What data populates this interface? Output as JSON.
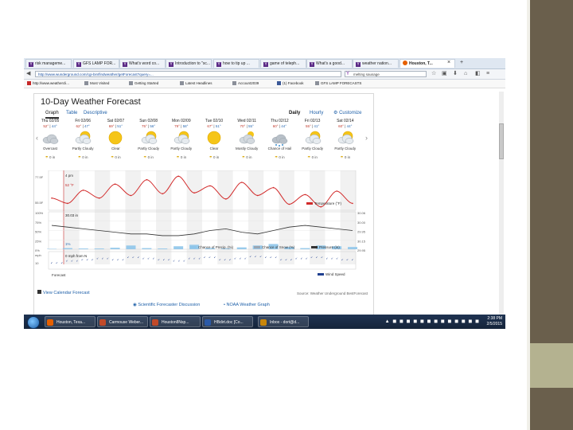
{
  "browser": {
    "tabs": [
      {
        "label": "risk manageme...",
        "icon": "Y"
      },
      {
        "label": "GFS LAMP FOR...",
        "icon": "Y"
      },
      {
        "label": "What's word co...",
        "icon": "Y"
      },
      {
        "label": "Introduction to \"sc...",
        "icon": "Y"
      },
      {
        "label": "how to tip up ...",
        "icon": "Y"
      },
      {
        "label": "game of teleph...",
        "icon": "Y"
      },
      {
        "label": "What's a good...",
        "icon": "Y"
      },
      {
        "label": "weather nation...",
        "icon": "Y"
      },
      {
        "label": "Houston, T...",
        "icon": "ff",
        "active": true
      }
    ],
    "close_tab": "×",
    "new_tab": "+",
    "url": "http://www.wunderground.com/cgi-bin/findweather/getForecast?query=...",
    "search_value": "melting sausage",
    "bookmarks": [
      "http://www.weathercli...",
      "Most Visited",
      "Getting Started",
      "Latest Headlines",
      "Account2039",
      "(1) Facebook",
      "GFS LAMP FORECASTS"
    ]
  },
  "page": {
    "title": "10-Day Weather Forecast",
    "tabs": [
      "Graph",
      "Table",
      "Descriptive"
    ],
    "active_tab": "Graph",
    "modes": [
      "Daily",
      "Hourly"
    ],
    "active_mode": "Daily",
    "customize": "Customize",
    "days": [
      {
        "day": "Thu 02/05",
        "hi": "52°",
        "lo": "44°",
        "icon": "cloudy",
        "cond": "Overcast",
        "precip": "0 in"
      },
      {
        "day": "Fri 02/06",
        "hi": "62°",
        "lo": "47°",
        "icon": "partly",
        "cond": "Partly Cloudy",
        "precip": "0 in"
      },
      {
        "day": "Sat 02/07",
        "hi": "69°",
        "lo": "51°",
        "icon": "sunny",
        "cond": "Clear",
        "precip": "0 in"
      },
      {
        "day": "Sun 02/08",
        "hi": "75°",
        "lo": "56°",
        "icon": "partly",
        "cond": "Partly Cloudy",
        "precip": "0 in"
      },
      {
        "day": "Mon 02/09",
        "hi": "79°",
        "lo": "58°",
        "icon": "partly",
        "cond": "Partly Cloudy",
        "precip": "0 in"
      },
      {
        "day": "Tue 02/10",
        "hi": "67°",
        "lo": "51°",
        "icon": "sunny",
        "cond": "Clear",
        "precip": "0 in"
      },
      {
        "day": "Wed 02/11",
        "hi": "70°",
        "lo": "55°",
        "icon": "mostly",
        "cond": "Mostly Cloudy",
        "precip": "0 in"
      },
      {
        "day": "Thu 02/12",
        "hi": "60°",
        "lo": "44°",
        "icon": "hail",
        "cond": "Chance of Hail",
        "precip": "0 in"
      },
      {
        "day": "Fri 02/13",
        "hi": "55°",
        "lo": "41°",
        "icon": "partly",
        "cond": "Partly Cloudy",
        "precip": "0 in"
      },
      {
        "day": "Sat 02/14",
        "hi": "60°",
        "lo": "44°",
        "icon": "partly",
        "cond": "Partly Cloudy",
        "precip": "0 in"
      }
    ],
    "prev_arrow": "‹",
    "next_arrow": "›",
    "graph": {
      "temp_annotation": "52 °F",
      "time_annotation": "4 pm",
      "pressure_annotation": "30.03 in",
      "precip_annotation": "1%",
      "wind_annotation": "0 mph from N",
      "forecast_label": "Forecast",
      "left_temp_ticks": [
        "77.5F",
        "55.5F"
      ],
      "left_pct_ticks": [
        "100%",
        "75%",
        "50%",
        "25%",
        "0%"
      ],
      "right_pressure_ticks": [
        "30.06",
        "30.00",
        "29.95",
        "30.15",
        "29.95"
      ],
      "left_wind_ticks": [
        "mph",
        "10"
      ],
      "legend_temp": "Temperature (°F)",
      "legend_precip": "Chance of Precip. (%)",
      "legend_snow": "Chance of Snow (%)",
      "legend_pressure": "Pressure (in)",
      "legend_wind": "Wind Speed",
      "source": "Source: Weather Underground BestForecast"
    },
    "view_calendar": "View Calendar Forecast",
    "scientific_link": "Scientific Forecaster Discussion",
    "nws_link": "NOAA Weather Graph"
  },
  "chart_data": {
    "type": "line",
    "title": "",
    "series": [
      {
        "name": "Temperature (°F)",
        "color": "#d22b2b",
        "values": [
          52,
          46,
          61,
          52,
          68,
          55,
          73,
          57,
          77,
          58,
          66,
          51,
          70,
          55,
          64,
          45,
          56,
          42,
          60,
          46
        ]
      },
      {
        "name": "Chance of Precip. (%)",
        "color": "#8ec5ea",
        "values": [
          1,
          3,
          2,
          2,
          4,
          10,
          3,
          2,
          8,
          12,
          3,
          2,
          5,
          10,
          14,
          6,
          3,
          10,
          8,
          6
        ]
      },
      {
        "name": "Pressure (in)",
        "color": "#333333",
        "values": [
          30.03,
          30.02,
          30.01,
          30.0,
          29.99,
          29.98,
          29.98,
          29.97,
          29.97,
          29.98,
          30.0,
          30.01,
          29.99,
          29.98,
          30.0,
          30.02,
          30.03,
          30.02,
          30.01,
          30.0
        ]
      },
      {
        "name": "Wind Speed",
        "color": "#1f3f8f",
        "values": [
          2,
          4,
          5,
          6,
          5,
          7,
          6,
          5,
          4,
          6,
          7,
          5,
          6,
          8,
          7,
          5,
          6,
          7,
          6,
          5
        ]
      }
    ],
    "ylim": [
      40,
      80
    ],
    "pressure_lim": [
      29.9,
      30.1
    ]
  },
  "taskbar": {
    "items": [
      {
        "label": "Houston, Texa...",
        "color": "#e66000"
      },
      {
        "label": "Carmouse Weber...",
        "color": "#c04a2a"
      },
      {
        "label": "Houston8Nsp...",
        "color": "#c04a2a"
      },
      {
        "label": "HBdirt.doc [Co...",
        "color": "#2b5aa8"
      },
      {
        "label": "Inbox - dort@d...",
        "color": "#c8860a"
      }
    ],
    "time": "2:38 PM",
    "date": "2/5/2015",
    "tray_icons": "▲ ◼ ◼ ◼ ◼ ◼ ◼ ◼ ◼ ◼ ◼ ◼ ◼ ◼"
  }
}
